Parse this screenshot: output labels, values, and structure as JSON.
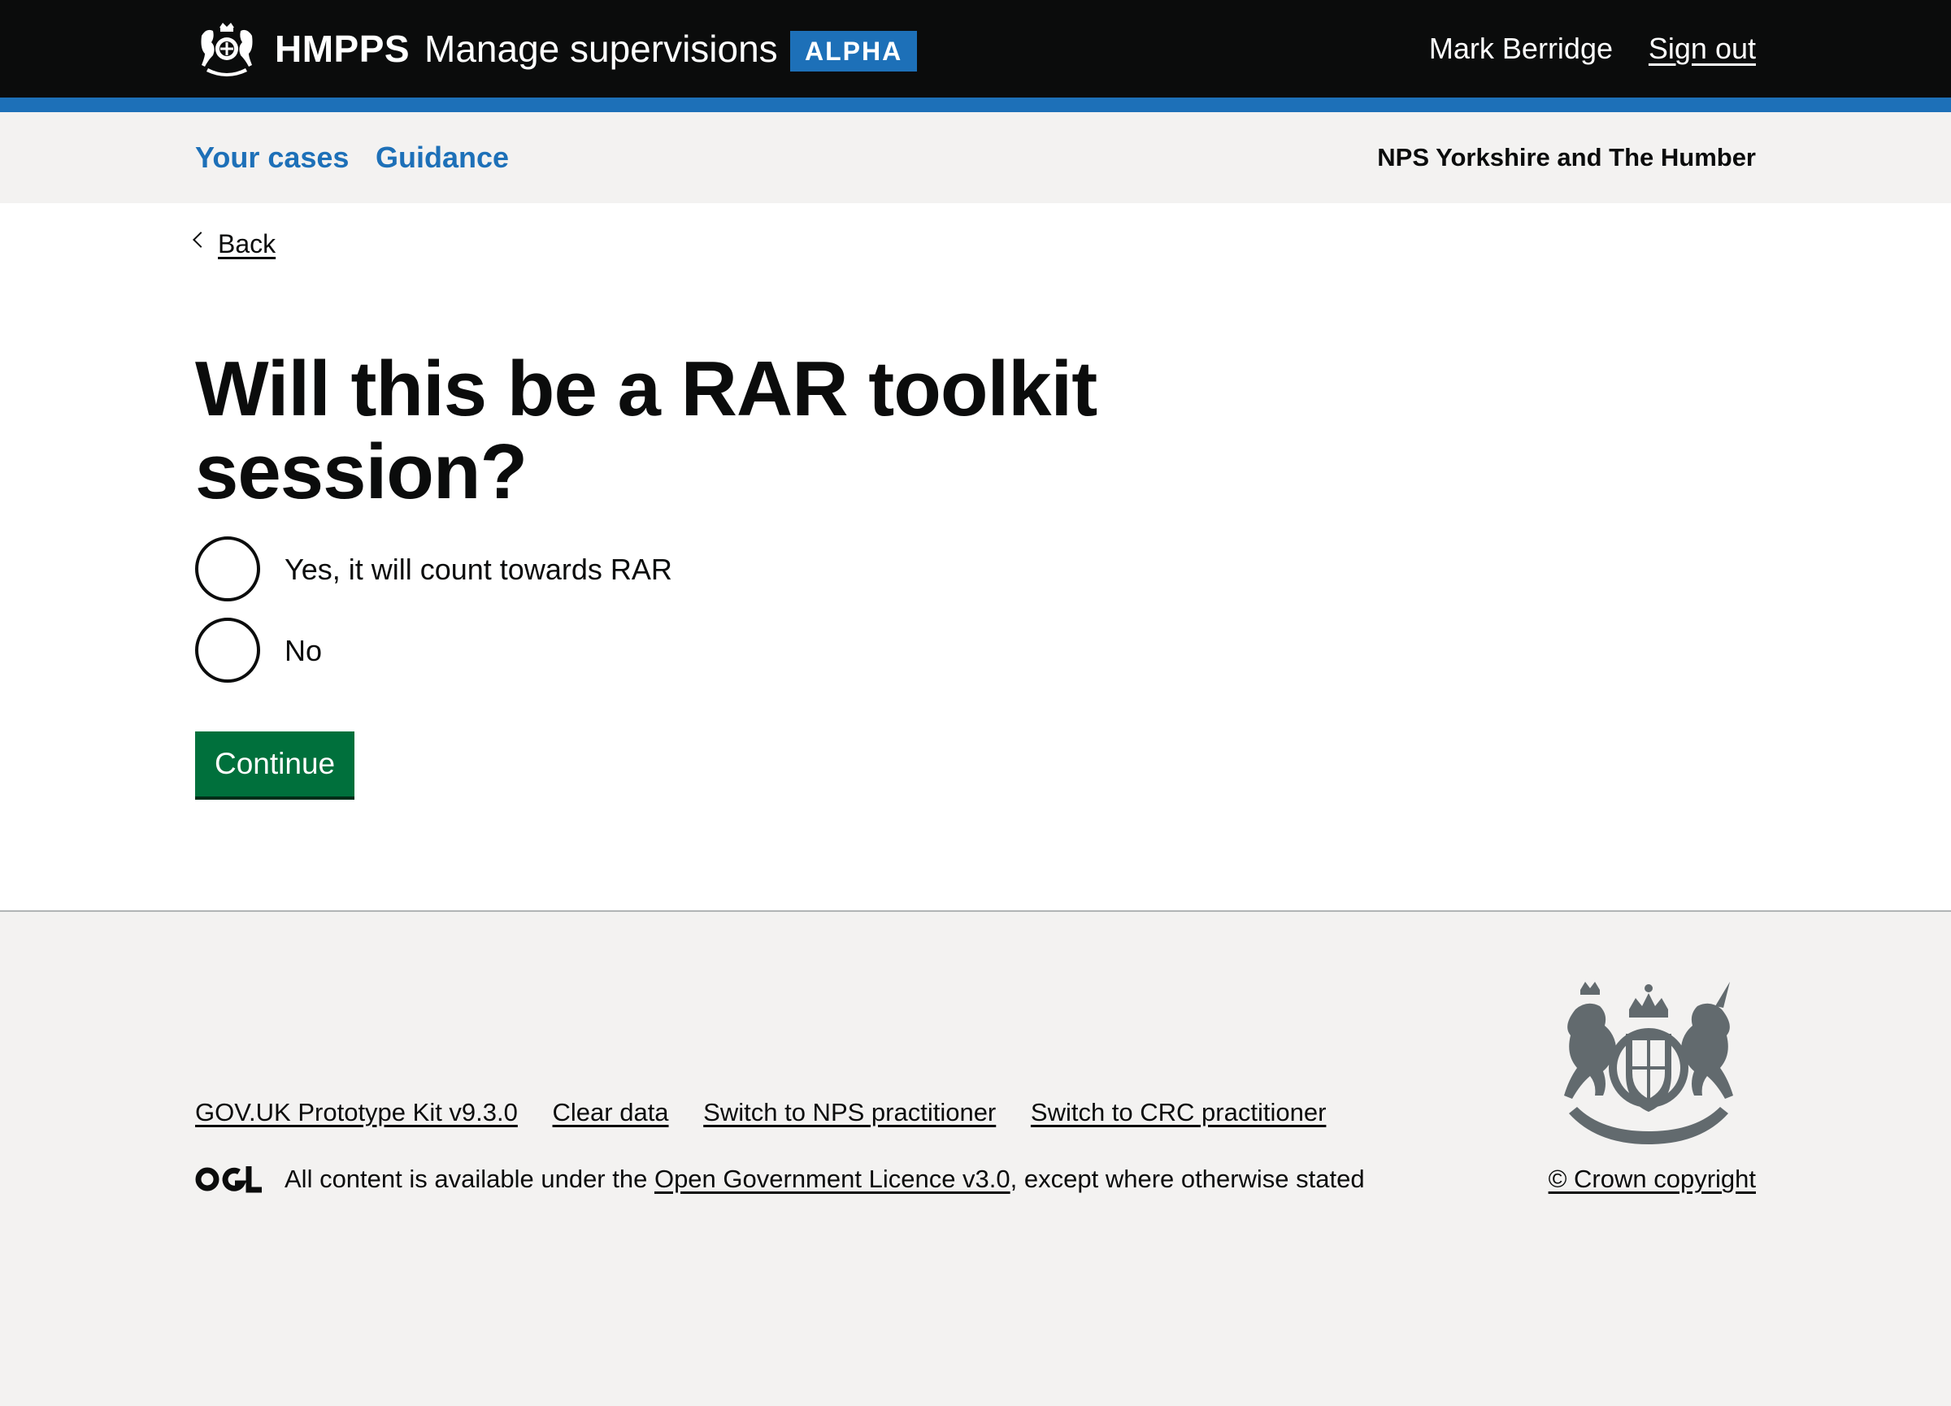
{
  "header": {
    "brand": "HMPPS",
    "service_name": "Manage supervisions",
    "phase_tag": "ALPHA",
    "user_name": "Mark Berridge",
    "sign_out": "Sign out",
    "crest_icon": "royal-crest-icon"
  },
  "subnav": {
    "items": [
      {
        "label": "Your cases"
      },
      {
        "label": "Guidance"
      }
    ],
    "region": "NPS Yorkshire and The Humber"
  },
  "main": {
    "back_link": "Back",
    "heading": "Will this be a RAR toolkit session?",
    "options": [
      {
        "label": "Yes, it will count towards RAR",
        "selected": false
      },
      {
        "label": "No",
        "selected": false
      }
    ],
    "continue_label": "Continue"
  },
  "footer": {
    "links": [
      {
        "label": "GOV.UK Prototype Kit v9.3.0"
      },
      {
        "label": "Clear data"
      },
      {
        "label": "Switch to NPS practitioner"
      },
      {
        "label": "Switch to CRC practitioner"
      }
    ],
    "licence_prefix": "All content is available under the ",
    "licence_link": "Open Government Licence v3.0",
    "licence_suffix": ", except where otherwise stated",
    "copyright": "© Crown copyright",
    "ogl_logo_text": "OGL"
  },
  "colors": {
    "header_bg": "#0b0c0c",
    "brand_blue": "#1d70b8",
    "button_green": "#00703c",
    "footer_bg": "#f3f2f1"
  }
}
